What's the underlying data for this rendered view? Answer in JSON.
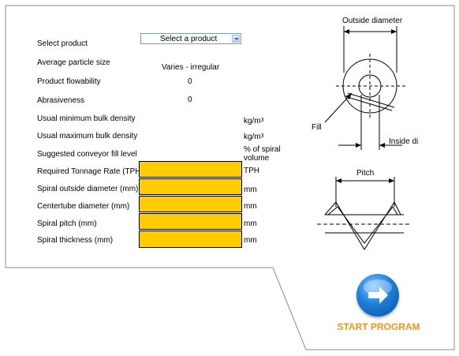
{
  "product_select": {
    "value": "Select a product"
  },
  "labels": {
    "select_product": "Select product",
    "avg_particle": "Average particle size",
    "flowability": "Product flowability",
    "abrasiveness": "Abrasiveness",
    "min_density": "Usual minimum bulk density",
    "max_density": "Usual maximum bulk density",
    "fill_level": "Suggested conveyor fill level",
    "tonnage": "Required Tonnage Rate (TPH)",
    "outside_dia": "Spiral outside diameter (mm)",
    "centertube": "Centertube diameter (mm)",
    "pitch": "Spiral pitch (mm)",
    "thickness": "Spiral thickness (mm)"
  },
  "values": {
    "avg_particle": "Varies - irregular",
    "flowability": "0",
    "abrasiveness": "0"
  },
  "units": {
    "density_base": "kg/m",
    "density_exp": "3",
    "fill_level_line1": "% of spiral",
    "fill_level_line2": "volume",
    "tph": "TPH",
    "mm": "mm"
  },
  "inputs": {
    "tonnage": "",
    "outside_dia": "",
    "centertube": "",
    "pitch": "",
    "thickness": ""
  },
  "diagram": {
    "outside_diameter": "Outside diameter",
    "fill": "Fill",
    "inside_diameter": "Inside di",
    "pitch": "Pitch"
  },
  "start_button": {
    "label": "START PROGRAM",
    "icon": "arrow-right-icon"
  },
  "colors": {
    "input_fill": "#ffcc00",
    "start_label": "#f7941d",
    "start_button": "#1d7fd8"
  }
}
